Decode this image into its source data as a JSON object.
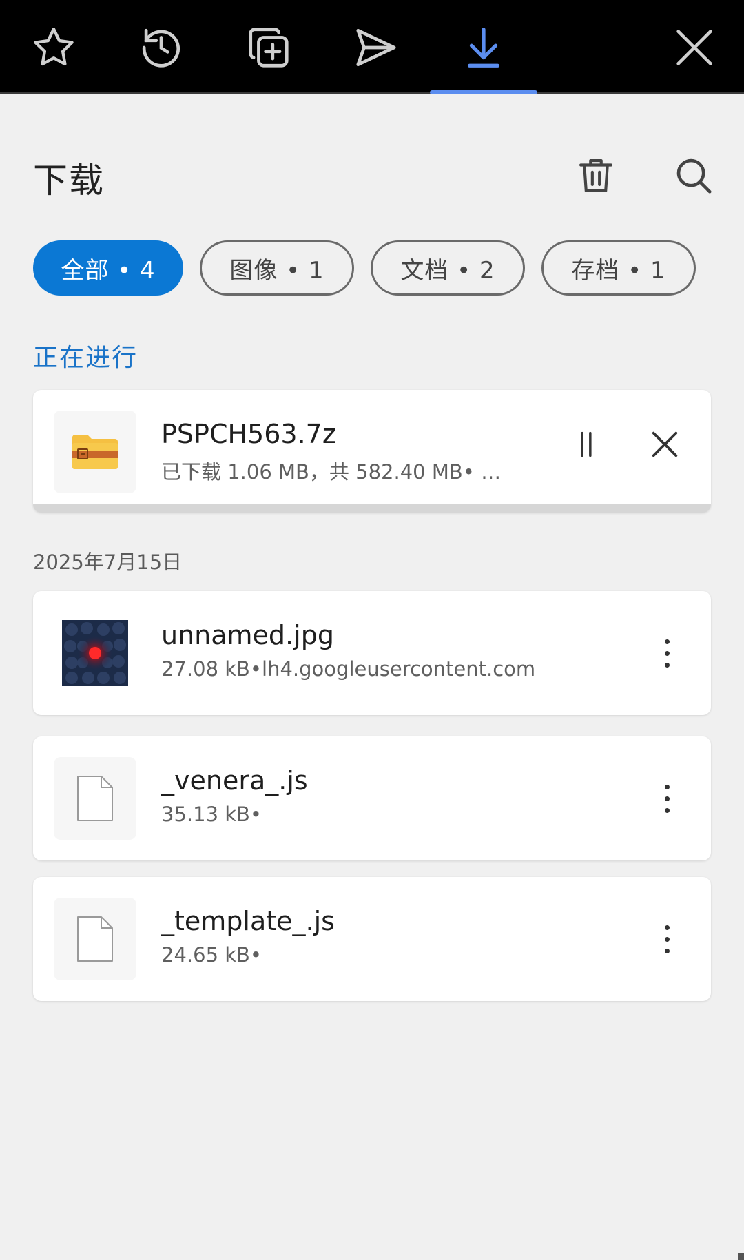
{
  "toolbar": {
    "tabs": [
      {
        "icon": "star-icon",
        "active": false
      },
      {
        "icon": "history-icon",
        "active": false
      },
      {
        "icon": "add-tab-icon",
        "active": false
      },
      {
        "icon": "send-icon",
        "active": false
      },
      {
        "icon": "download-icon",
        "active": true
      }
    ],
    "close_icon": "close-icon",
    "accent_color": "#5b8def"
  },
  "header": {
    "title": "下载",
    "delete_icon": "trash-icon",
    "search_icon": "search-icon"
  },
  "filters": [
    {
      "label": "全部 • 4",
      "active": true
    },
    {
      "label": "图像 • 1",
      "active": false
    },
    {
      "label": "文档 • 2",
      "active": false
    },
    {
      "label": "存档 • 1",
      "active": false
    }
  ],
  "in_progress": {
    "section_label": "正在进行",
    "item": {
      "name": "PSPCH563.7z",
      "meta": "已下载 1.06 MB，共 582.40 MB• 剩…",
      "icon": "archive-folder-icon",
      "progress_fraction": 0.0018
    }
  },
  "history": {
    "date_label": "2025年7月15日",
    "items": [
      {
        "name": "unnamed.jpg",
        "meta": "27.08 kB•lh4.googleusercontent.com",
        "icon": "image-thumbnail"
      },
      {
        "name": "_venera_.js",
        "meta": "35.13 kB•",
        "icon": "file-icon"
      },
      {
        "name": "_template_.js",
        "meta": "24.65 kB•",
        "icon": "file-icon"
      }
    ]
  },
  "colors": {
    "primary": "#0b78d4",
    "link": "#1a73c8",
    "background": "#f0f0f0"
  }
}
